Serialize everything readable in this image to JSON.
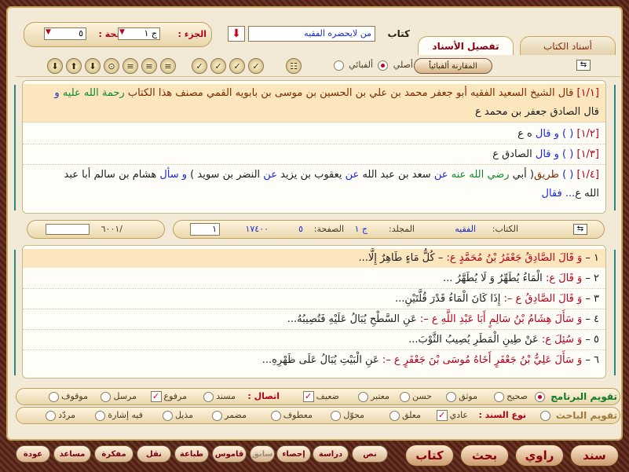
{
  "top": {
    "book_label": "كتاب",
    "book_value": "من لايحضره الفقيه",
    "juz_label": "الجزء :",
    "juz_value": "ج ١",
    "page_label": "الصفحة :",
    "page_value": "٥"
  },
  "tabs": [
    {
      "label": "أسناد الكتاب"
    },
    {
      "label": "تفصيل الأسناد"
    }
  ],
  "toolbar": {
    "compare_label": "المقارنة ألفبائياً",
    "asli_label": "أصلي",
    "alphabetic_label": "ألفبائي"
  },
  "chains": [
    {
      "num": "[١/١]",
      "parts": [
        {
          "t": " قال الشيخ السعيد الفقيه أبو جعفر محمد بن علي بن الحسين بن موسى بن بابويه القمي مصنف هذا الكتاب ",
          "c": "brown"
        },
        {
          "t": "رحمة الله عليه",
          "c": "green"
        },
        {
          "t": " و",
          "c": "blue"
        }
      ]
    },
    {
      "num": "",
      "parts": [
        {
          "t": "قال الصادق جعفر بن محمد ع",
          "c": "dark"
        }
      ]
    },
    {
      "num": "[١/٢]",
      "parts": [
        {
          "t": " ( ) و قال ",
          "c": "blue"
        },
        {
          "t": "ه ع",
          "c": "dark"
        }
      ]
    },
    {
      "num": "[١/٣]",
      "parts": [
        {
          "t": " ( ) و قال ",
          "c": "blue"
        },
        {
          "t": "الصادق ع",
          "c": "dark"
        }
      ]
    },
    {
      "num": "[١/٤]",
      "parts": [
        {
          "t": " ( ) ",
          "c": "blue"
        },
        {
          "t": "طريق",
          "c": "brown"
        },
        {
          "t": "( أبي ",
          "c": "dark"
        },
        {
          "t": "رضي الله عنه",
          "c": "green"
        },
        {
          "t": " عن ",
          "c": "blue"
        },
        {
          "t": "سعد بن عبد الله ",
          "c": "dark"
        },
        {
          "t": "عن",
          "c": "blue"
        },
        {
          "t": " يعقوب بن يزيد ",
          "c": "dark"
        },
        {
          "t": "عن",
          "c": "blue"
        },
        {
          "t": " النضر بن سويد ) ",
          "c": "dark"
        },
        {
          "t": "و سأل",
          "c": "blue"
        },
        {
          "t": " هشام بن سالم أبا عبد",
          "c": "dark"
        }
      ]
    },
    {
      "num": "",
      "parts": [
        {
          "t": "الله ع",
          "c": "dark"
        },
        {
          "t": "... فقال",
          "c": "blue"
        }
      ]
    }
  ],
  "info": {
    "book_label": "الكتاب:",
    "book_value": "الفقيه",
    "volume_label": "المجلد:",
    "volume_value": "ج ١",
    "page_label": "الصفحة:",
    "page_value": "٥",
    "id_value": "١٧٤٠٠",
    "num_value": "١",
    "total_value": "/٦٠٠١"
  },
  "hadiths": [
    {
      "prefix": "١ – ",
      "red": "وَ قَالَ الصَّادِقُ جَعْفَرُ بْنُ مُحَمَّدٍ ع:",
      "black": " – كُلُّ مَاءٍ طَاهِرٌ إِلَّا..."
    },
    {
      "prefix": "٢ – ",
      "red": "وَ قَالَ ع:",
      "black": " الْمَاءُ يُطَهِّرُ وَ لَا يُطَهَّرُ ..."
    },
    {
      "prefix": "٣ – ",
      "red": "وَ قَالَ الصَّادِقُ ع –:",
      "black": " إِذَا كَانَ الْمَاءُ قَدْرَ قُلَّتَيْنِ..."
    },
    {
      "prefix": "٤ – ",
      "red": "وَ سَأَلَ هِشَامُ بْنُ سَالِمٍ أَبَا عَبْدِ اللَّهِ ع –:",
      "black": " عَنِ السَّطْحِ يُبَالُ عَلَيْهِ فَتُصِيبُهُ..."
    },
    {
      "prefix": "٥ – ",
      "red": "وَ سُئِلَ ع:",
      "black": " عَنْ طِينِ الْمَطَرِ يُصِيبُ الثَّوْبَ..."
    },
    {
      "prefix": "٦ – ",
      "red": "وَ سَأَلَ عَلِيُّ بْنُ جَعْفَرٍ أَخَاهُ مُوسَى بْنَ جَعْفَرٍ ع –:",
      "black": " عَنِ الْبَيْتِ يُبَالُ عَلَى ظَهْرِهِ..."
    }
  ],
  "grading": {
    "program_label": "تقويم البرنامج",
    "researcher_label": "تقويم الباحث",
    "row1": [
      "صحيح",
      "موثق",
      "حسن",
      "معتبر",
      "ضعيف"
    ],
    "ittisal_label": "اتصال :",
    "row1b": [
      "مسند",
      "مرفوع",
      "مرسل",
      "موقوف"
    ],
    "sanad_label": "نوع السند :",
    "row2": [
      "عادي",
      "معلق",
      "محوّل",
      "معطوف",
      "مضمر",
      "مذيل",
      "فيه إشارة",
      "مردّد"
    ]
  },
  "bottom": {
    "sanad": "سند",
    "rawi": "راوي",
    "bahth": "بحث",
    "kitab": "كتاب",
    "nass": "نص",
    "dirasa": "دراسة",
    "ihsa": "إحصاء",
    "sabiq": "سابق",
    "qamoos": "قاموس",
    "tibaa": "طباعة",
    "naql": "نقل",
    "mufakkira": "مفكرة",
    "musaid": "مساعد",
    "awda": "عودة"
  },
  "colors": {
    "accent": "#b0001c",
    "frame": "#5a2a1e",
    "highlight": "#fbe6bd"
  }
}
